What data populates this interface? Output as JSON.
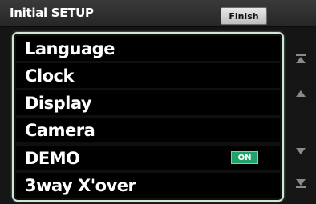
{
  "header": {
    "title": "Initial SETUP",
    "finish_label": "Finish"
  },
  "menu": {
    "items": [
      {
        "label": "Language"
      },
      {
        "label": "Clock"
      },
      {
        "label": "Display"
      },
      {
        "label": "Camera"
      },
      {
        "label": "DEMO",
        "toggle": "ON"
      },
      {
        "label": "3way X'over"
      }
    ]
  },
  "scroll": {
    "icons": [
      "scroll-to-top-icon",
      "scroll-up-icon",
      "scroll-down-icon",
      "scroll-to-bottom-icon"
    ]
  },
  "colors": {
    "accent_frame": "#cfe7d4",
    "toggle_on": "#1fa36a",
    "scroll_arrow": "#8a8a8a"
  }
}
